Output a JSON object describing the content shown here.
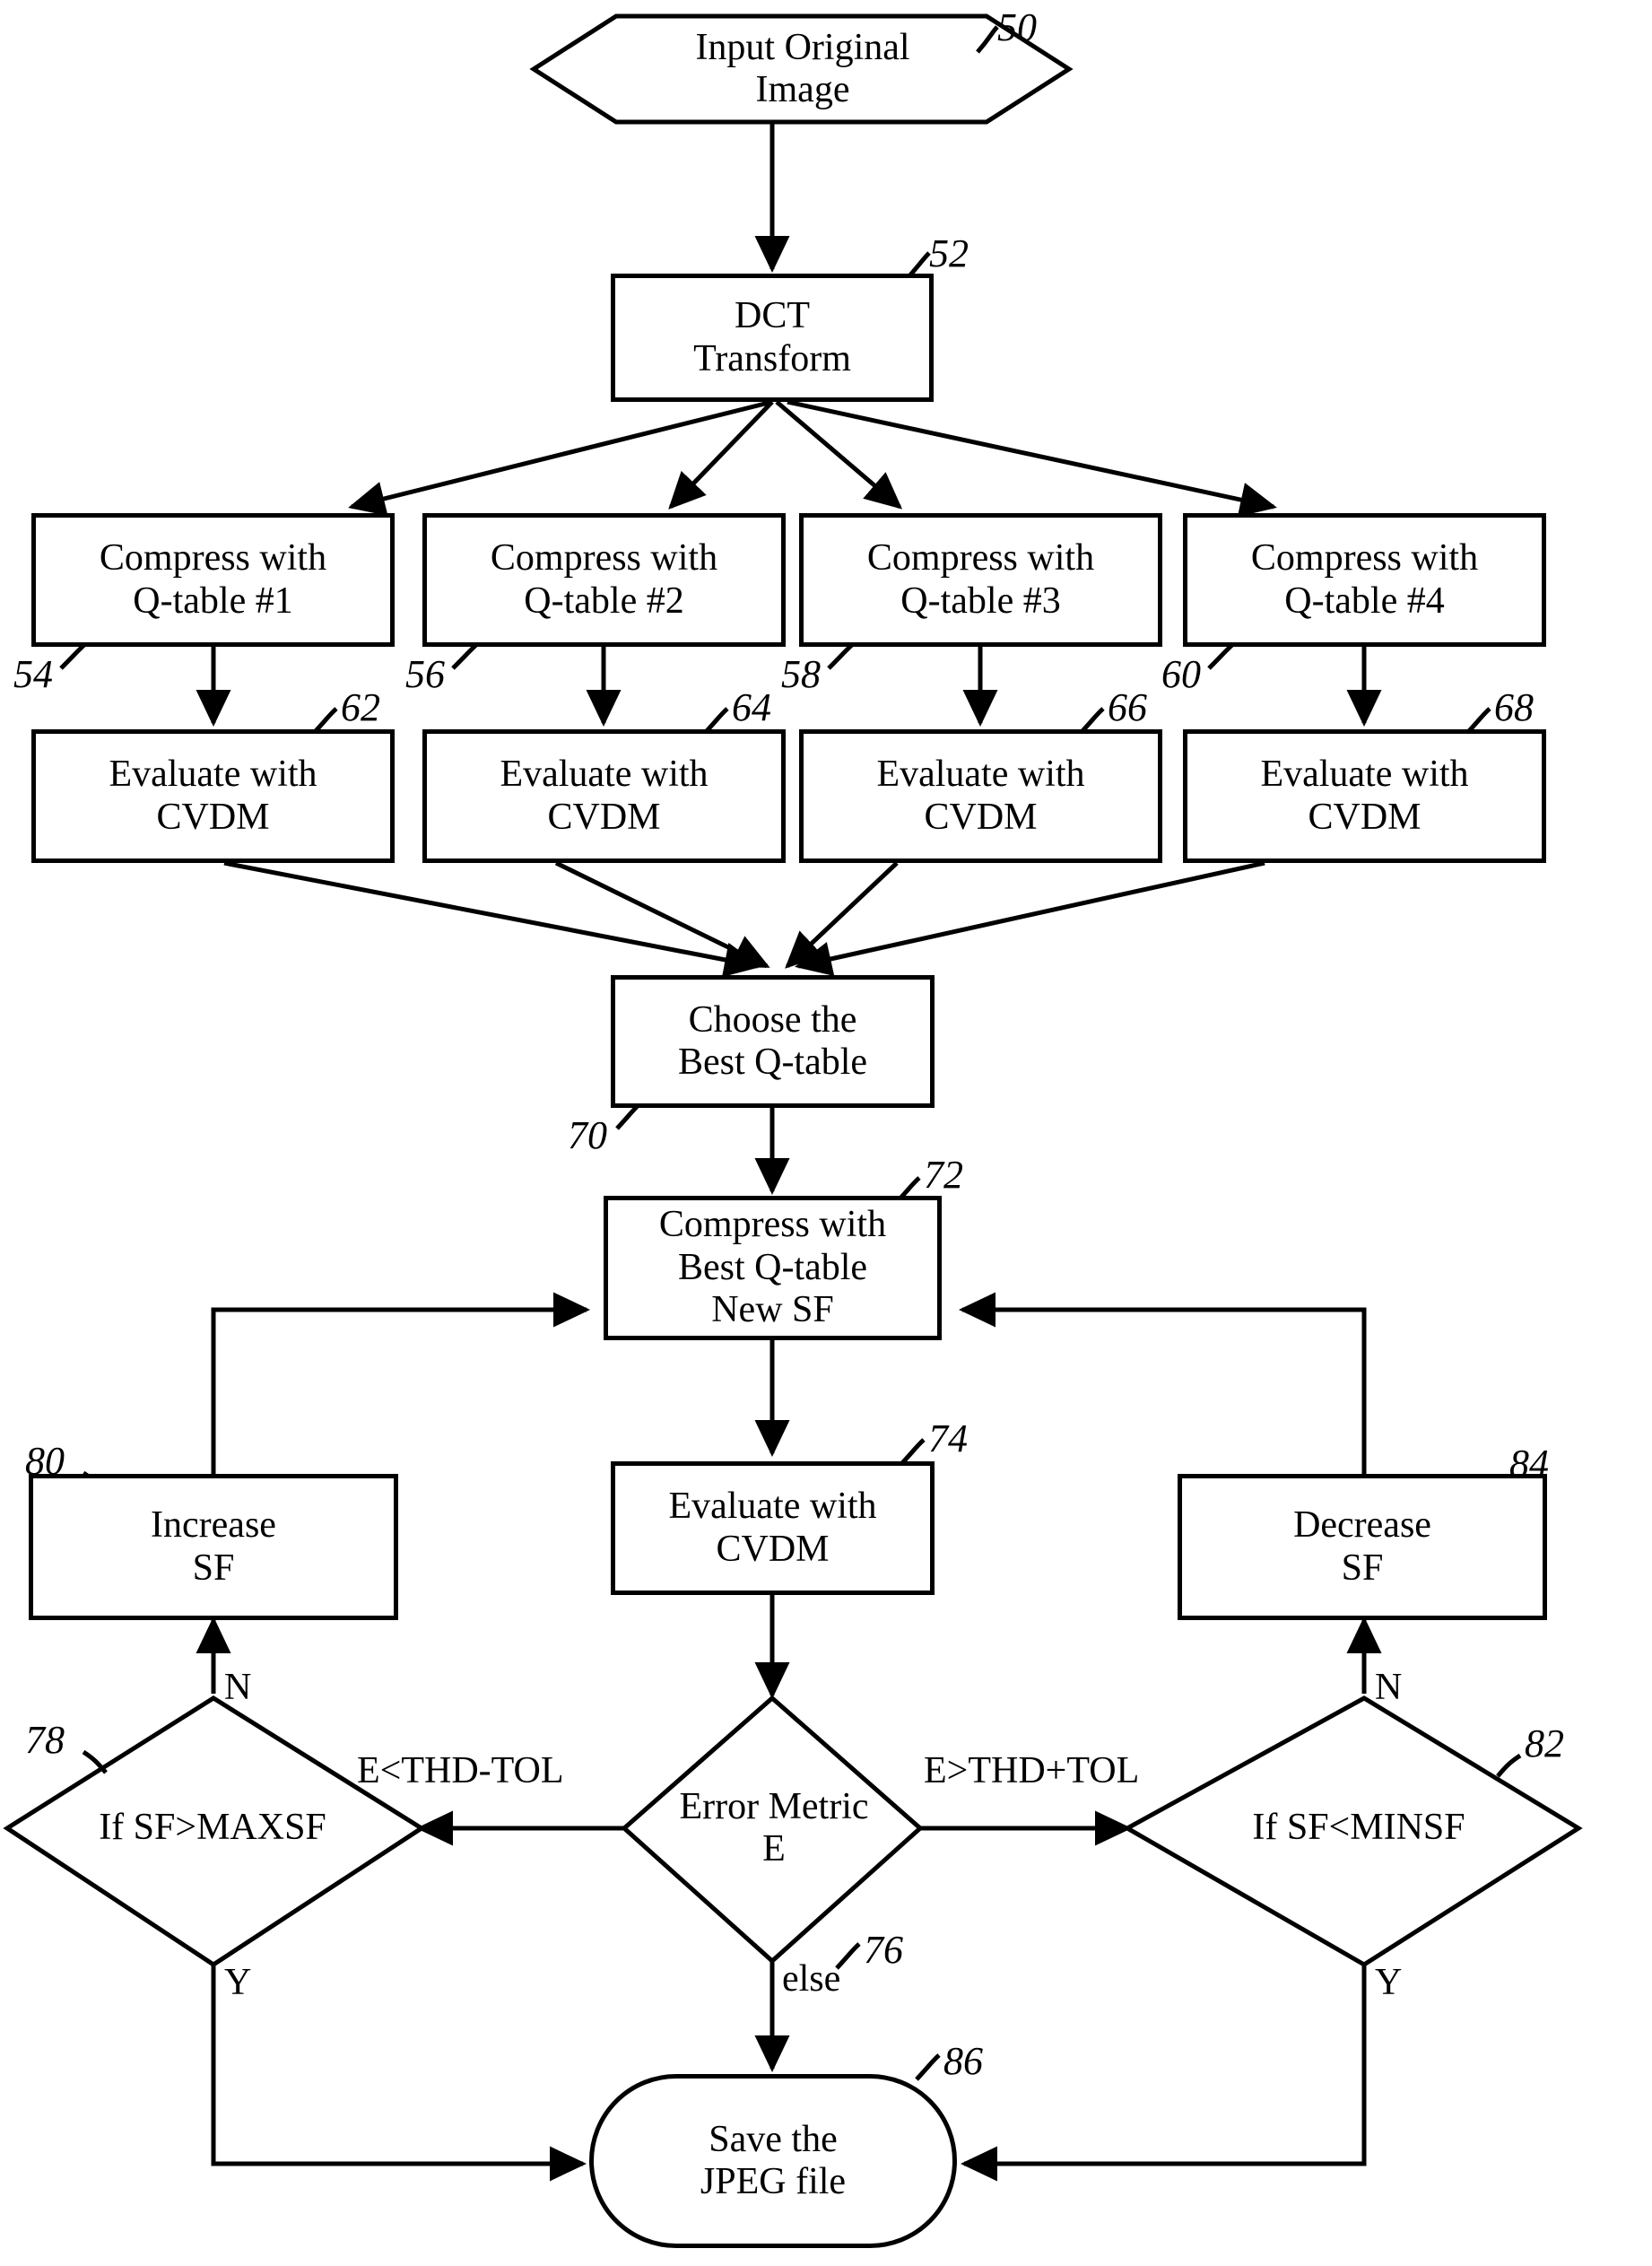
{
  "figure": {
    "type": "flowchart",
    "title": "JPEG compression quality-optimization flowchart"
  },
  "nodes": [
    {
      "id": "n50",
      "shape": "hexagon",
      "label": "Input Original\nImage",
      "ref": "50"
    },
    {
      "id": "n52",
      "shape": "process",
      "label": "DCT\nTransform",
      "ref": "52"
    },
    {
      "id": "n54",
      "shape": "process",
      "label": "Compress with\nQ-table #1",
      "ref": "54"
    },
    {
      "id": "n56",
      "shape": "process",
      "label": "Compress with\nQ-table #2",
      "ref": "56"
    },
    {
      "id": "n58",
      "shape": "process",
      "label": "Compress with\nQ-table #3",
      "ref": "58"
    },
    {
      "id": "n60",
      "shape": "process",
      "label": "Compress with\nQ-table #4",
      "ref": "60"
    },
    {
      "id": "n62",
      "shape": "process",
      "label": "Evaluate with\nCVDM",
      "ref": "62"
    },
    {
      "id": "n64",
      "shape": "process",
      "label": "Evaluate with\nCVDM",
      "ref": "64"
    },
    {
      "id": "n66",
      "shape": "process",
      "label": "Evaluate with\nCVDM",
      "ref": "66"
    },
    {
      "id": "n68",
      "shape": "process",
      "label": "Evaluate with\nCVDM",
      "ref": "68"
    },
    {
      "id": "n70",
      "shape": "process",
      "label": "Choose the\nBest Q-table",
      "ref": "70"
    },
    {
      "id": "n72",
      "shape": "process",
      "label": "Compress with\nBest Q-table\nNew SF",
      "ref": "72"
    },
    {
      "id": "n74",
      "shape": "process",
      "label": "Evaluate with\nCVDM",
      "ref": "74"
    },
    {
      "id": "n76",
      "shape": "decision",
      "label": "Error Metric\nE",
      "ref": "76"
    },
    {
      "id": "n78",
      "shape": "decision",
      "label": "If SF>MAXSF",
      "ref": "78"
    },
    {
      "id": "n80",
      "shape": "process",
      "label": "Increase\nSF",
      "ref": "80"
    },
    {
      "id": "n82",
      "shape": "decision",
      "label": "If SF<MINSF",
      "ref": "82"
    },
    {
      "id": "n84",
      "shape": "process",
      "label": "Decrease\nSF",
      "ref": "84"
    },
    {
      "id": "n86",
      "shape": "terminator",
      "label": "Save the\nJPEG file",
      "ref": "86"
    }
  ],
  "edge_labels": [
    {
      "id": "el_lt",
      "text": "E<THD-TOL"
    },
    {
      "id": "el_gt",
      "text": "E>THD+TOL"
    },
    {
      "id": "el_else",
      "text": "else"
    },
    {
      "id": "el_n78",
      "text": "N"
    },
    {
      "id": "el_y78",
      "text": "Y"
    },
    {
      "id": "el_n82",
      "text": "N"
    },
    {
      "id": "el_y82",
      "text": "Y"
    }
  ],
  "reference_numerals": [
    "50",
    "52",
    "54",
    "56",
    "58",
    "60",
    "62",
    "64",
    "66",
    "68",
    "70",
    "72",
    "74",
    "76",
    "78",
    "80",
    "82",
    "84",
    "86"
  ],
  "colors": {
    "stroke": "#000000",
    "background": "#ffffff",
    "text": "#000000"
  }
}
